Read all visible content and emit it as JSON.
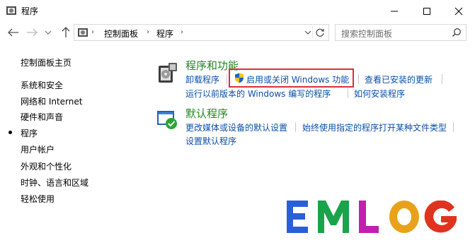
{
  "window": {
    "title": "程序",
    "controls": {
      "minimize": "minimize-icon",
      "maximize": "maximize-icon",
      "close": "close-icon"
    }
  },
  "address_bar": {
    "breadcrumbs": [
      "控制面板",
      "程序"
    ],
    "search_placeholder": "搜索控制面板"
  },
  "sidebar": {
    "home": "控制面板主页",
    "items": [
      {
        "label": "系统和安全",
        "active": false
      },
      {
        "label": "网络和 Internet",
        "active": false
      },
      {
        "label": "硬件和声音",
        "active": false
      },
      {
        "label": "程序",
        "active": true
      },
      {
        "label": "用户帐户",
        "active": false
      },
      {
        "label": "外观和个性化",
        "active": false
      },
      {
        "label": "时钟、语言和区域",
        "active": false
      },
      {
        "label": "轻松使用",
        "active": false
      }
    ]
  },
  "main": {
    "programs": {
      "title": "程序和功能",
      "links": {
        "uninstall": "卸载程序",
        "windows_features": "启用或关闭 Windows 功能",
        "installed_updates": "查看已安装的更新",
        "run_older": "运行以前版本的 Windows 编写的程序",
        "how_to_install": "如何安装程序"
      }
    },
    "defaults": {
      "title": "默认程序",
      "links": {
        "autoplay": "更改媒体或设备的默认设置",
        "file_types": "始终使用指定的程序打开某种文件类型",
        "set_defaults": "设置默认程序"
      }
    }
  },
  "watermark": {
    "text": "EMLOG",
    "letter_colors": [
      "#2b5fd9",
      "#1aa34a",
      "#c21fb0",
      "#e8a21a",
      "#e0331f"
    ]
  },
  "colors": {
    "link": "#0a4fa8",
    "category_title": "#1e8a1e",
    "highlight_border": "#d6303a"
  }
}
